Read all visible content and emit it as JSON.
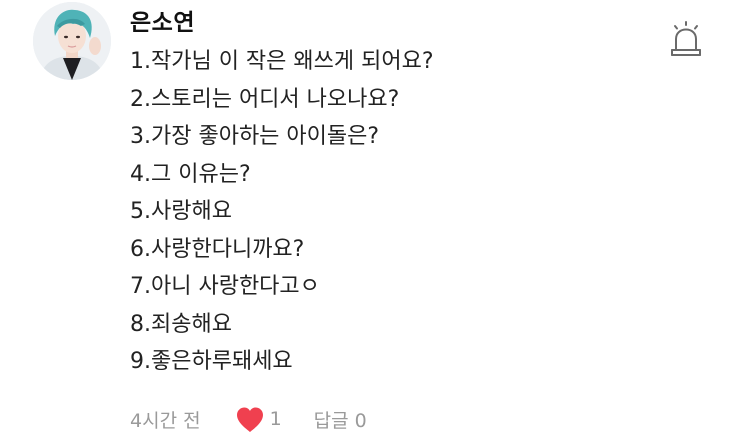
{
  "comment": {
    "author": "은소연",
    "lines": [
      "1.작가님 이 작은 왜쓰게 되어요?",
      "2.스토리는 어디서 나오나요?",
      "3.가장 좋아하는 아이돌은?",
      "4.그 이유는?",
      "5.사랑해요",
      "6.사랑한다니까요?",
      "7.아니 사랑한다고ㅇ",
      "8.죄송해요",
      "9.좋은하루돼세요"
    ],
    "time": "4시간 전",
    "like_count": "1",
    "reply_label": "답글 0",
    "icons": {
      "report": "siren-icon",
      "like": "heart-icon"
    },
    "colors": {
      "heart": "#f0404f",
      "meta_text": "#9a9a9a",
      "avatar_hair": "#4fb3b7"
    }
  }
}
